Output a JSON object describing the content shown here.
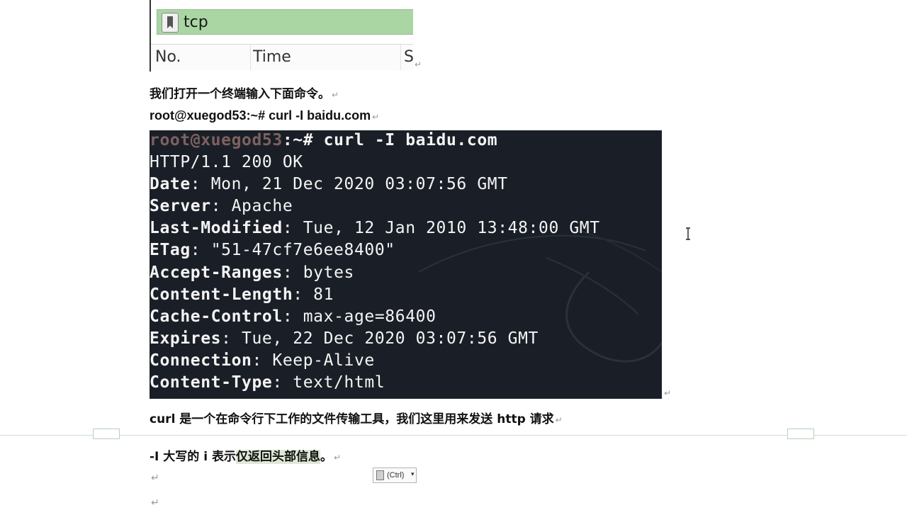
{
  "wireshark": {
    "filter_text": "tcp",
    "columns": [
      "No.",
      "Time",
      "S"
    ]
  },
  "doc": {
    "para1": "我们打开一个终端输入下面命令。",
    "para2": "root@xuegod53:~# curl -I baidu.com",
    "para3": "curl  是一个在命令行下工作的文件传输工具，我们这里用来发送 http 请求",
    "para4_a": "-I  大写的 i  表示",
    "para4_hl": "仅返回头部信息",
    "para4_b": "。",
    "return_mark": "↵"
  },
  "terminal": {
    "prompt_user": "root@xuegod53",
    "prompt_rest": ":~# curl -I baidu.com",
    "lines": [
      {
        "key": "",
        "val": "HTTP/1.1 200 OK"
      },
      {
        "key": "Date",
        "val": ": Mon, 21 Dec 2020 03:07:56 GMT"
      },
      {
        "key": "Server",
        "val": ": Apache"
      },
      {
        "key": "Last-Modified",
        "val": ": Tue, 12 Jan 2010 13:48:00 GMT"
      },
      {
        "key": "ETag",
        "val": ": \"51-47cf7e6ee8400\""
      },
      {
        "key": "Accept-Ranges",
        "val": ": bytes"
      },
      {
        "key": "Content-Length",
        "val": ": 81"
      },
      {
        "key": "Cache-Control",
        "val": ": max-age=86400"
      },
      {
        "key": "Expires",
        "val": ": Tue, 22 Dec 2020 03:07:56 GMT"
      },
      {
        "key": "Connection",
        "val": ": Keep-Alive"
      },
      {
        "key": "Content-Type",
        "val": ": text/html"
      }
    ]
  },
  "paste_options": {
    "label": "(Ctrl)",
    "arrow": "▾"
  },
  "colors": {
    "terminal_bg": "#1a1f27",
    "filter_bg": "#a9d6a2",
    "highlight": "#dfe9d5"
  }
}
